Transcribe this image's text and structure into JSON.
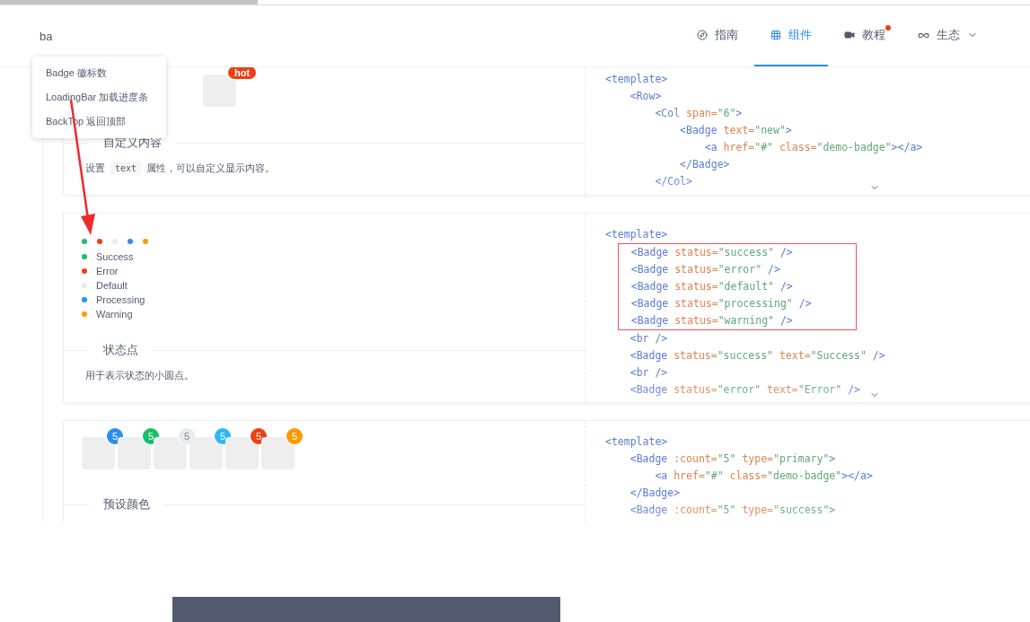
{
  "loading_bar": {
    "level": 0.25
  },
  "search": {
    "value": "ba"
  },
  "nav": [
    {
      "label": "指南",
      "selected": false,
      "dot": false,
      "dropdown": false
    },
    {
      "label": "组件",
      "selected": true,
      "dot": false,
      "dropdown": false
    },
    {
      "label": "教程",
      "selected": false,
      "dot": true,
      "dropdown": false
    },
    {
      "label": "生态",
      "selected": false,
      "dot": false,
      "dropdown": true
    }
  ],
  "search_results": [
    "Badge 徽标数",
    "LoadingBar 加载进度条",
    "BackTop 返回顶部"
  ],
  "cards": [
    {
      "kind": "custom",
      "badge_text": "hot",
      "title": "自定义内容",
      "description": {
        "before": "设置",
        "code": "text",
        "after": "属性，可以自定义显示内容。"
      },
      "code": [
        {
          "boxed": false,
          "lines": [
            "<template>",
            "    <Row>",
            "        <Col span=\"6\">",
            "            <Badge text=\"new\">",
            "                <a href=\"#\" class=\"demo-badge\"></a>",
            "            </Badge>",
            "        </Col>"
          ]
        }
      ]
    },
    {
      "kind": "status",
      "dots": [
        {
          "color": "#19be6b"
        },
        {
          "color": "#ed4014"
        },
        {
          "color": "#e6ebf1"
        },
        {
          "color": "#2d8cf0"
        },
        {
          "color": "#ff9900"
        }
      ],
      "items": [
        {
          "color": "#19be6b",
          "label": "Success"
        },
        {
          "color": "#ed4014",
          "label": "Error"
        },
        {
          "color": "#e6ebf1",
          "label": "Default"
        },
        {
          "color": "#2d8cf0",
          "label": "Processing"
        },
        {
          "color": "#ff9900",
          "label": "Warning"
        }
      ],
      "title": "状态点",
      "description": {
        "before": "用于表示状态的小圆点。"
      },
      "code": [
        {
          "boxed": false,
          "lines": [
            "<template>"
          ]
        },
        {
          "boxed": true,
          "lines": [
            "    <Badge status=\"success\" />",
            "    <Badge status=\"error\" />",
            "    <Badge status=\"default\" />",
            "    <Badge status=\"processing\" />",
            "    <Badge status=\"warning\" />"
          ]
        },
        {
          "boxed": false,
          "lines": [
            "    <br />",
            "    <Badge status=\"success\" text=\"Success\" />",
            "    <br />",
            "    <Badge status=\"error\" text=\"Error\" />"
          ]
        }
      ]
    },
    {
      "kind": "preset",
      "counts": [
        {
          "text": "5",
          "color": "#2d8cf0"
        },
        {
          "text": "5",
          "color": "#19be6b"
        },
        {
          "text": "5",
          "color": "#e6ebf1"
        },
        {
          "text": "5",
          "color": "#2db7f5"
        },
        {
          "text": "5",
          "color": "#ed4014"
        },
        {
          "text": "5",
          "color": "#ff9900"
        }
      ],
      "title": "预设颜色",
      "code": [
        {
          "boxed": false,
          "lines": [
            "<template>",
            "    <Badge :count=\"5\" type=\"primary\">",
            "        <a href=\"#\" class=\"demo-badge\"></a>",
            "    </Badge>",
            "    <Badge :count=\"5\" type=\"success\">"
          ]
        }
      ]
    }
  ]
}
